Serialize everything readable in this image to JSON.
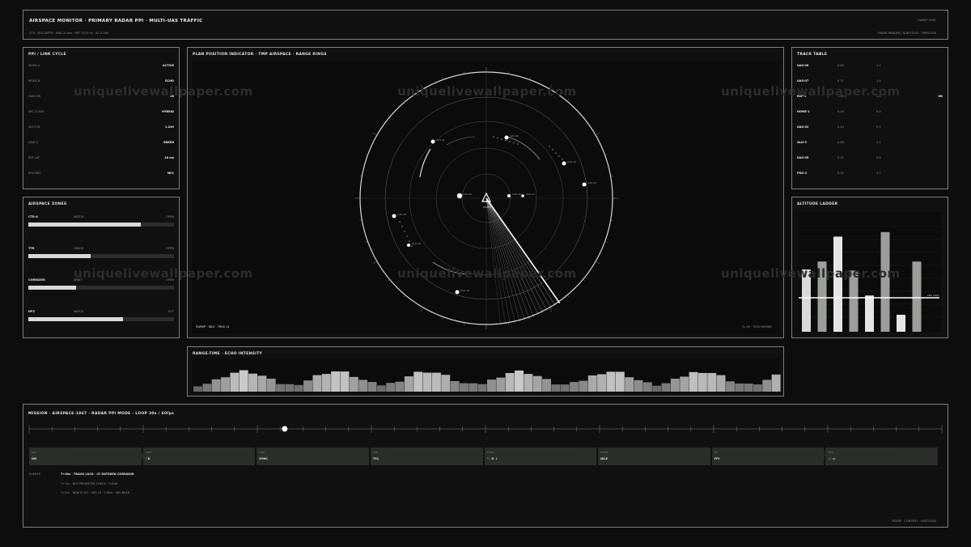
{
  "header": {
    "title": "AIRSPACE MONITOR · PRIMARY RADAR PPI · MULTI-UAS TRAFFIC",
    "subtitle": "CTX · SFX-DEPTH · RNG 3.0km · PRF 1275 Hz · AZ 0-360",
    "status": "SWEEP SYNC",
    "right_meta": "FRAME RENDER / SUBTITLED · TIMECODE"
  },
  "watermark": "uniquelivewallpaper.com",
  "ppi_cycle": {
    "title": "PPI / LINK CYCLE",
    "rows": [
      {
        "k": "MODE A",
        "v": "ACTIVE"
      },
      {
        "k": "MODE B",
        "v": "ECHO"
      },
      {
        "k": "GAIN DB",
        "v": "28"
      },
      {
        "k": "SRC CLASS",
        "v": "HYBRID"
      },
      {
        "k": "SECTOR",
        "v": "1.249"
      },
      {
        "k": "LINK Q",
        "v": "GREEN"
      },
      {
        "k": "REF LAT",
        "v": "18 ms"
      },
      {
        "k": "RECORD",
        "v": "98%"
      }
    ]
  },
  "zones": {
    "title": "AIRSPACE ZONES",
    "items": [
      {
        "name": "CTR-A",
        "mid": "WATCH",
        "state": "OPEN",
        "fill": 0.77
      },
      {
        "name": "TFR",
        "mid": "GRADE",
        "state": "OPEN",
        "fill": 0.43
      },
      {
        "name": "CORRIDOR",
        "mid": "ARBIT",
        "state": "OPEN",
        "fill": 0.33
      },
      {
        "name": "NFZ",
        "mid": "WATCH",
        "state": "HOT",
        "fill": 0.65
      }
    ]
  },
  "radar": {
    "title": "PLAN POSITION INDICATOR · TMP AIRSPACE · RANGE RINGS",
    "footer_left": "SWEEP · IDLE · TRKS 12",
    "footer_right": "CL 06 · TRCK BEHIND",
    "center_label": "HOME",
    "contacts": [
      {
        "label": "UAS 01"
      },
      {
        "label": "UAS 02"
      },
      {
        "label": "UAS 03"
      },
      {
        "label": "UAS 04"
      },
      {
        "label": "UAS 05"
      },
      {
        "label": "UAS 06"
      },
      {
        "label": "UAS 07"
      },
      {
        "label": "UAS 08"
      },
      {
        "label": "UAS 09"
      },
      {
        "label": "UAS 10"
      }
    ]
  },
  "track_table": {
    "title": "TRACK TABLE",
    "rows": [
      {
        "id": "UAS-06",
        "a": "0.64",
        "b": "1.2",
        "c": ""
      },
      {
        "id": "UAS-07",
        "a": "0.71",
        "b": "1.4",
        "c": ""
      },
      {
        "id": "REF-1",
        "a": "1.00",
        "b": "1.0",
        "c": "OK"
      },
      {
        "id": "HOME-1",
        "a": "0.00",
        "b": "0.0",
        "c": ""
      },
      {
        "id": "UAS-02",
        "a": "0.43",
        "b": "0.9",
        "c": ""
      },
      {
        "id": "GLD-3",
        "a": "0.88",
        "b": "2.1",
        "c": ""
      },
      {
        "id": "UAS-05",
        "a": "0.37",
        "b": "0.8",
        "c": ""
      },
      {
        "id": "PKG-3",
        "a": "0.92",
        "b": "1.7",
        "c": ""
      }
    ]
  },
  "altitude": {
    "title": "ALTITUDE LADDER",
    "threshold_label": "CEIL 120m",
    "threshold": 0.3
  },
  "range_time": {
    "title": "RANGE-TIME · ECHO INTENSITY",
    "left_tick": "0km",
    "right_tick": "3km"
  },
  "mission": {
    "title": "MISSION · AIRSPACE-1867 · RADAR PPI MODE · LOOP 30s / 60fps",
    "progress": 0.28,
    "cells": [
      {
        "t": "REC",
        "v": "ON"
      },
      {
        "t": "SYNC",
        "v": "OK"
      },
      {
        "t": "LINK",
        "v": "SYNC"
      },
      {
        "t": "TRK",
        "v": "TS1"
      },
      {
        "t": "ECHO",
        "v": "MEDIA"
      },
      {
        "t": "STATE",
        "v": "IDLE"
      },
      {
        "t": "FR",
        "v": "FPI"
      },
      {
        "t": "RNG",
        "v": "3km"
      }
    ],
    "log_label": "EVENTS",
    "log": [
      "T+00s · TRACK LOCK · 07 ENTERED CORRIDOR",
      "T+12s · NFZ PERIMETER CHECK · CLEAR",
      "T+20s · NEW ECHO · UAS 10 · 0.8km · 080 BEAR"
    ],
    "footer": "FRAME · CONTENT · SUBTITLED"
  },
  "colors": {
    "background": "#0c0d0c",
    "panel_border": "#7d807c",
    "accent": "#ffffff"
  }
}
